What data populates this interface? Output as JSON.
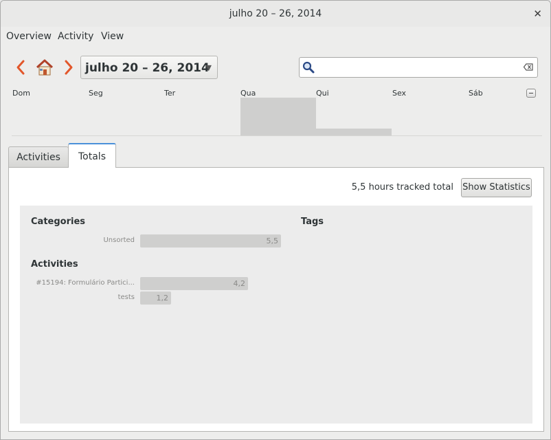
{
  "window": {
    "title": "julho 20 – 26, 2014"
  },
  "menu": [
    "Overview",
    "Activity",
    "View"
  ],
  "toolbar": {
    "date_range": "julho 20 – 26, 2014",
    "icons": {
      "prev": "chevron-left-icon",
      "home": "home-icon",
      "next": "chevron-right-icon",
      "search": "search-icon",
      "clear": "clear-icon"
    }
  },
  "search": {
    "value": "",
    "placeholder": ""
  },
  "days": [
    "Dom",
    "Seg",
    "Ter",
    "Qua",
    "Qui",
    "Sex",
    "Sáb"
  ],
  "day_activity_fraction": [
    0,
    0,
    0,
    1.0,
    0.18,
    0,
    0
  ],
  "tabs": [
    {
      "label": "Activities",
      "selected": false
    },
    {
      "label": "Totals",
      "selected": true
    }
  ],
  "totals": {
    "tracked_text": "5,5 hours tracked total",
    "show_statistics": "Show Statistics",
    "categories_heading": "Categories",
    "activities_heading": "Activities",
    "tags_heading": "Tags",
    "categories": [
      {
        "name": "Unsorted",
        "value": "5,5",
        "hours": 5.5
      }
    ],
    "activities": [
      {
        "name": "#15194: Formulário Partici...",
        "value": "4,2",
        "hours": 4.2
      },
      {
        "name": "tests",
        "value": "1,2",
        "hours": 1.2
      }
    ]
  },
  "colors": {
    "accent": "#4a90d9",
    "bar": "#cfcfce",
    "nav_arrow": "#e2572b"
  }
}
